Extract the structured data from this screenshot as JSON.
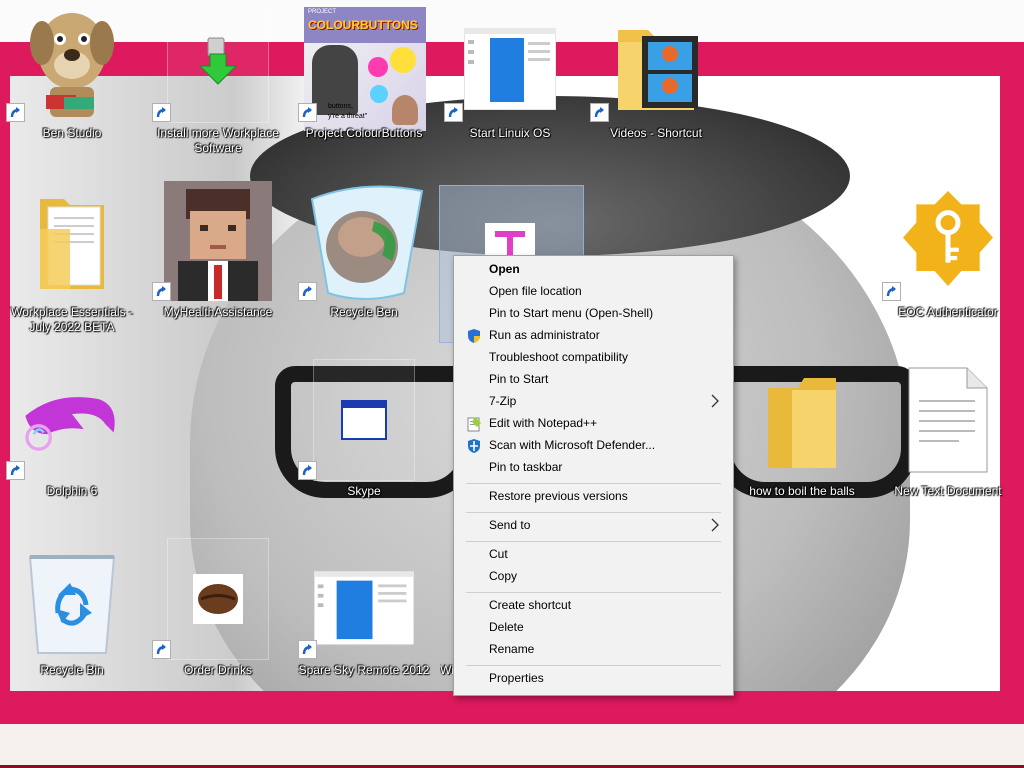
{
  "desktop_icons": [
    {
      "label": "Ben Studio"
    },
    {
      "label": "Install more Workplace Software"
    },
    {
      "label": "Project ColourButtons"
    },
    {
      "label": "Start Linuix OS"
    },
    {
      "label": "Videos - Shortcut"
    },
    {
      "label": "Workplace Essentials - July 2022 BETA"
    },
    {
      "label": "MyHealthAssistance"
    },
    {
      "label": "Recycle Ben"
    },
    {
      "label": "EOC Authenticator"
    },
    {
      "label": "Dolphin 6"
    },
    {
      "label": "Skype"
    },
    {
      "label": "how to boil the balls"
    },
    {
      "label": "New Text Document"
    },
    {
      "label": "Recycle Bin"
    },
    {
      "label": "Order Drinks"
    },
    {
      "label": "Spare Sky Remote 2012"
    },
    {
      "label": "Wi"
    }
  ],
  "thumb_text": {
    "colour_buttons_title": "COLOURBUTTONS",
    "colour_buttons_small": "PROJECT",
    "colour_buttons_caption1": "buttons,",
    "colour_buttons_caption2": "y're a threat\""
  },
  "context_menu": {
    "open": "Open",
    "open_file_location": "Open file location",
    "pin_start_menu": "Pin to Start menu (Open-Shell)",
    "run_as_admin": "Run as administrator",
    "troubleshoot": "Troubleshoot compatibility",
    "pin_to_start": "Pin to Start",
    "seven_zip": "7-Zip",
    "edit_notepad": "Edit with Notepad++",
    "scan_defender": "Scan with Microsoft Defender...",
    "pin_taskbar": "Pin to taskbar",
    "restore_versions": "Restore previous versions",
    "send_to": "Send to",
    "cut": "Cut",
    "copy": "Copy",
    "create_shortcut": "Create shortcut",
    "delete": "Delete",
    "rename": "Rename",
    "properties": "Properties"
  },
  "colors": {
    "frame": "#dd1a5e",
    "menu_bg": "#f2f2f2",
    "selection": "#aabedc"
  }
}
